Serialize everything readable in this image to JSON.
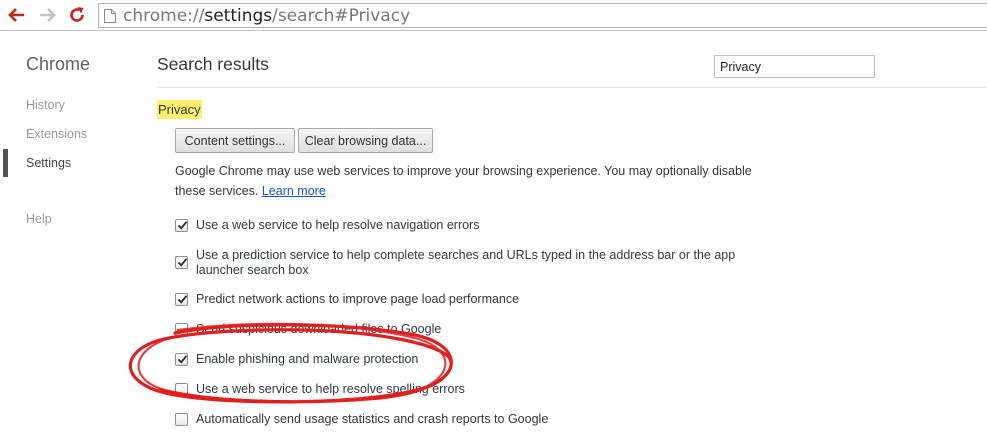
{
  "toolbar": {
    "url_scheme": "chrome://",
    "url_host": "settings",
    "url_path": "/search#Privacy"
  },
  "sidebar": {
    "title": "Chrome",
    "items": [
      {
        "label": "History"
      },
      {
        "label": "Extensions"
      },
      {
        "label": "Settings",
        "active": true
      },
      {
        "label": "Help"
      }
    ]
  },
  "main": {
    "title": "Search results",
    "search_value": "Privacy",
    "section_title": "Privacy",
    "buttons": {
      "content_settings": "Content settings...",
      "clear_browsing": "Clear browsing data..."
    },
    "description": "Google Chrome may use web services to improve your browsing experience. You may optionally disable these services.",
    "learn_more": "Learn more",
    "options": [
      {
        "label": "Use a web service to help resolve navigation errors",
        "checked": true
      },
      {
        "label": "Use a prediction service to help complete searches and URLs typed in the address bar or the app launcher search box",
        "checked": true
      },
      {
        "label": "Predict network actions to improve page load performance",
        "checked": true
      },
      {
        "label": "Send suspicious downloaded files to Google",
        "checked": false
      },
      {
        "label": "Enable phishing and malware protection",
        "checked": true
      },
      {
        "label": "Use a web service to help resolve spelling errors",
        "checked": false
      },
      {
        "label": "Automatically send usage statistics and crash reports to Google",
        "checked": false
      }
    ]
  },
  "colors": {
    "highlight": "#fdee6c",
    "link": "#1155cc",
    "annotation": "#e0201e",
    "nav_red": "#c5251b"
  },
  "icons": [
    "back-arrow-icon",
    "forward-arrow-icon",
    "reload-icon",
    "page-icon",
    "checkmark-icon"
  ]
}
